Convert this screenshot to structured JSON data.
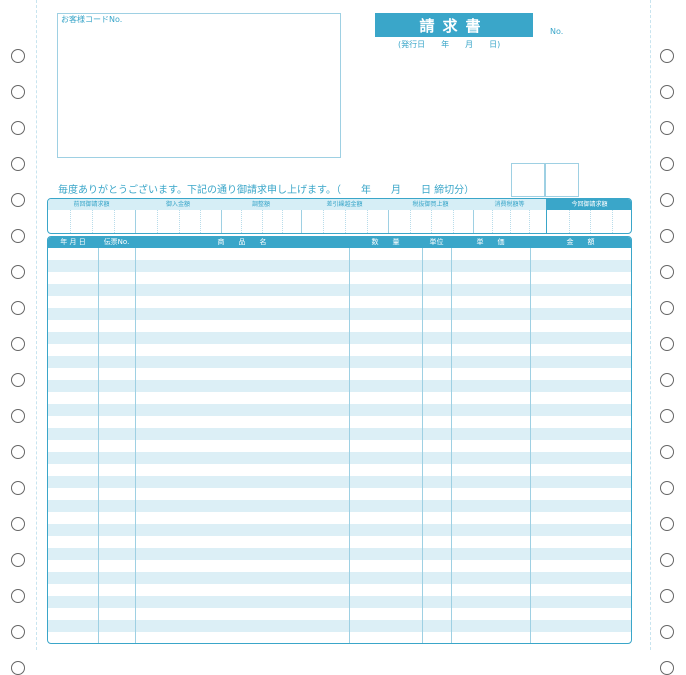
{
  "customer_code_label": "お客様コードNo.",
  "title": "請求書",
  "issue_date": "(発行日　　年　　月　　日)",
  "number_label": "No.",
  "greeting": "毎度ありがとうございます。下記の通り御請求申し上げます。（　　年　　月　　日 締切分）",
  "summary_columns": [
    {
      "label": "前回御請求額"
    },
    {
      "label": "御入金額"
    },
    {
      "label": "調整額"
    },
    {
      "label": "差引繰越金額"
    },
    {
      "label": "税抜御買上額"
    },
    {
      "label": "消費税額等"
    },
    {
      "label": "今回御請求額",
      "highlight": true
    }
  ],
  "table_headers": [
    "年 月 日",
    "伝票No.",
    "商　　品　　名",
    "数　　量",
    "単位",
    "単　　価",
    "金　　額"
  ],
  "colors": {
    "accent": "#3aa6c9",
    "light_fill": "#dceff6",
    "line": "#9ed0e3"
  }
}
